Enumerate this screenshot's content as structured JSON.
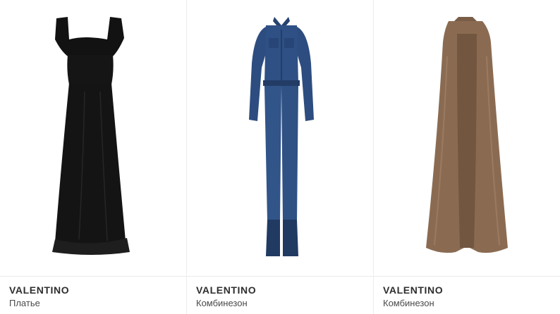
{
  "products": [
    {
      "brand": "VALENTINO",
      "type": "Платье",
      "item_color": "#111111"
    },
    {
      "brand": "VALENTINO",
      "type": "Комбинезон",
      "item_color": "#2c4a7a"
    },
    {
      "brand": "VALENTINO",
      "type": "Комбинезон",
      "item_color": "#8a6b52"
    }
  ]
}
